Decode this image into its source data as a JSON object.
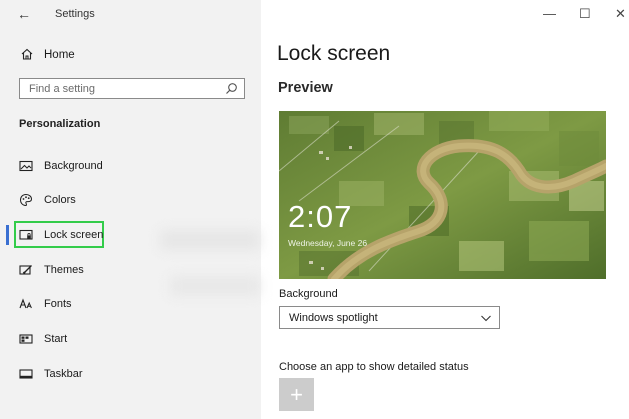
{
  "window": {
    "title": "Settings",
    "back_glyph": "←",
    "minimize_glyph": "—",
    "maximize_glyph": "☐",
    "close_glyph": "✕"
  },
  "sidebar": {
    "home": {
      "label": "Home",
      "icon": "home-icon"
    },
    "search": {
      "placeholder": "Find a setting",
      "icon": "search-icon"
    },
    "section_title": "Personalization",
    "items": [
      {
        "label": "Background",
        "icon": "picture-icon"
      },
      {
        "label": "Colors",
        "icon": "palette-icon"
      },
      {
        "label": "Lock screen",
        "icon": "lock-screen-icon",
        "selected": true
      },
      {
        "label": "Themes",
        "icon": "themes-icon"
      },
      {
        "label": "Fonts",
        "icon": "fonts-icon"
      },
      {
        "label": "Start",
        "icon": "start-icon"
      },
      {
        "label": "Taskbar",
        "icon": "taskbar-icon"
      }
    ]
  },
  "main": {
    "title": "Lock screen",
    "preview_heading": "Preview",
    "preview": {
      "time": "2:07",
      "date": "Wednesday, June 26"
    },
    "background_label": "Background",
    "background_value": "Windows spotlight",
    "status_label": "Choose an app to show detailed status",
    "add_button_glyph": "+"
  },
  "colors": {
    "accent": "#3a6fd1",
    "highlight": "#33cc4a",
    "sidebar_bg": "#f2f2f2"
  }
}
